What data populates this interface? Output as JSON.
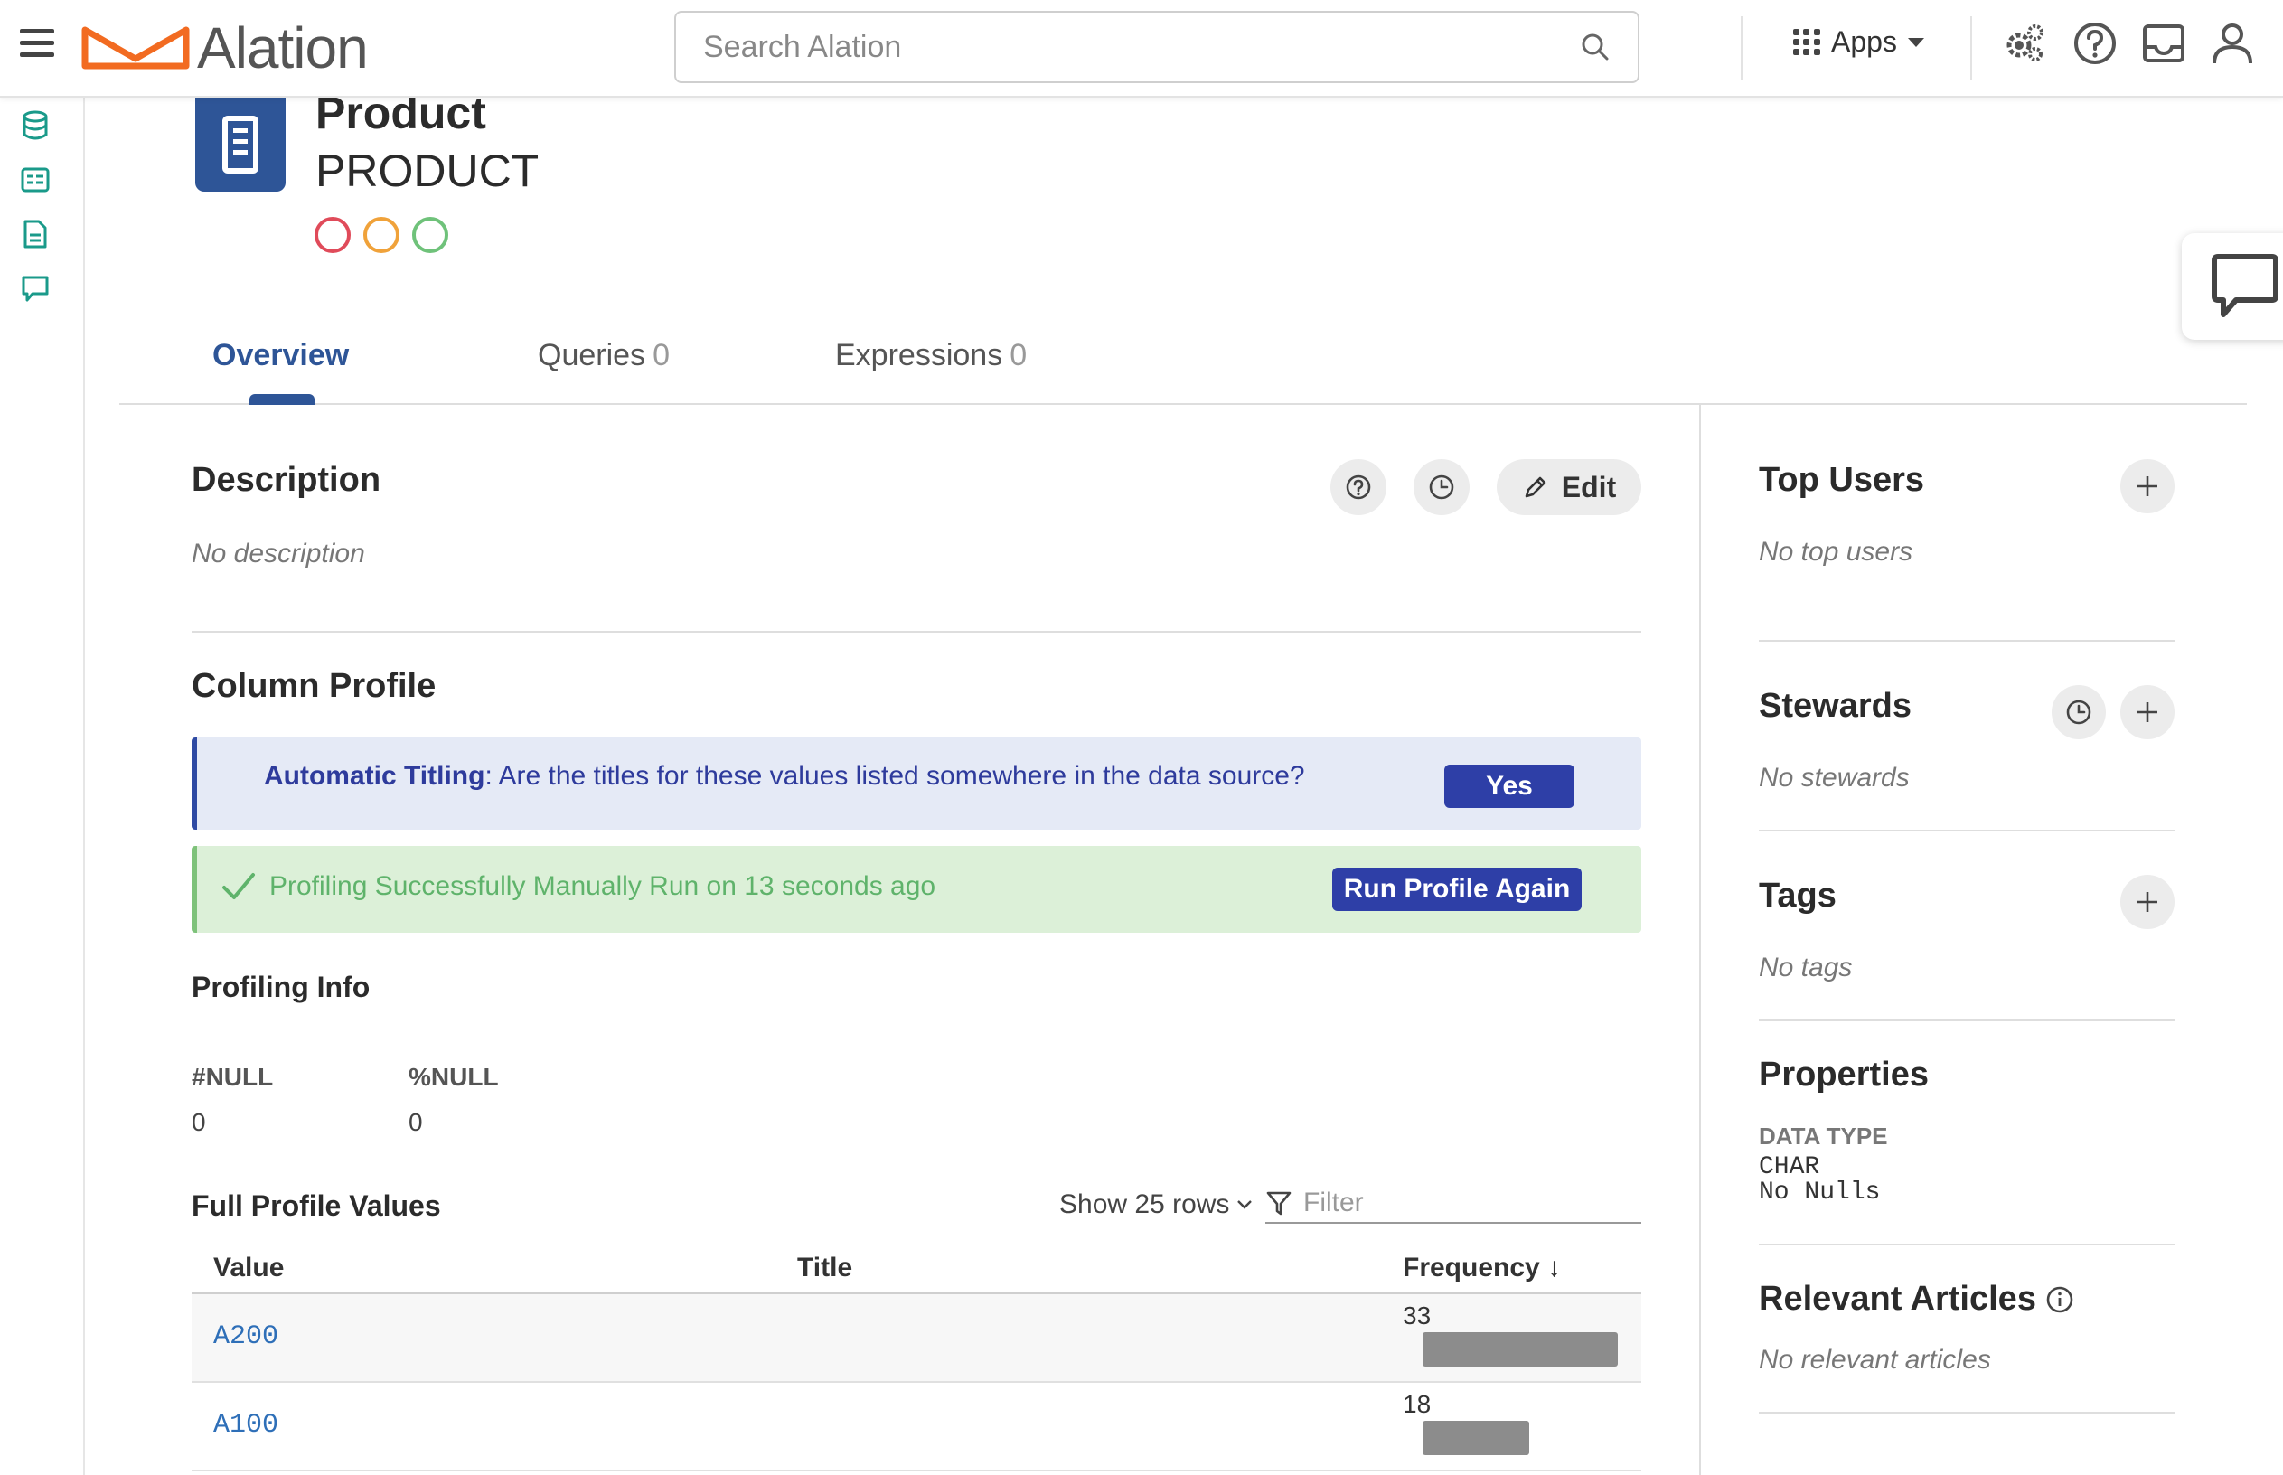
{
  "app": {
    "brand": "Alation",
    "search_placeholder": "Search Alation",
    "apps_label": "Apps"
  },
  "header": {
    "title": "Product",
    "subtitle": "PRODUCT"
  },
  "tabs": [
    {
      "label": "Overview",
      "count": ""
    },
    {
      "label": "Queries",
      "count": "0"
    },
    {
      "label": "Expressions",
      "count": "0"
    }
  ],
  "description": {
    "title": "Description",
    "empty": "No description",
    "edit_label": "Edit"
  },
  "column_profile": {
    "title": "Column Profile",
    "titling_bold": "Automatic Titling",
    "titling_text": ": Are the titles for these values listed somewhere in the data source?",
    "yes_label": "Yes",
    "success_text": "Profiling Successfully Manually Run on 13 seconds ago",
    "run_again_label": "Run Profile Again",
    "profiling_info_title": "Profiling Info",
    "stats": [
      {
        "label": "#NULL",
        "value": "0"
      },
      {
        "label": "%NULL",
        "value": "0"
      }
    ],
    "full_profile_title": "Full Profile Values",
    "show_rows": "Show 25 rows",
    "filter_placeholder": "Filter",
    "columns": [
      "Value",
      "Title",
      "Frequency ↓"
    ],
    "rows": [
      {
        "value": "A200",
        "title": "",
        "frequency": "33",
        "bar_fraction": 1.0
      },
      {
        "value": "A100",
        "title": "",
        "frequency": "18",
        "bar_fraction": 0.545
      }
    ]
  },
  "sidebar": {
    "top_users": {
      "title": "Top Users",
      "empty": "No top users"
    },
    "stewards": {
      "title": "Stewards",
      "empty": "No stewards"
    },
    "tags": {
      "title": "Tags",
      "empty": "No tags"
    },
    "properties": {
      "title": "Properties",
      "data_type_label": "DATA TYPE",
      "data_type": "CHAR",
      "nulls": "No Nulls"
    },
    "relevant_articles": {
      "title": "Relevant Articles",
      "empty": "No relevant articles"
    }
  },
  "colors": {
    "accent": "#2e5597",
    "primary_button": "#2e3fa7",
    "info_banner": "#e5eaf6",
    "success_banner": "#dcf0d8",
    "success_text": "#5fb36b",
    "logo_orange": "#f26b21",
    "rail_teal": "#1a9a8a",
    "trust_red": "#e04b5a",
    "trust_orange": "#f0a23a",
    "trust_green": "#6fc27a"
  },
  "icons": [
    "hamburger-icon",
    "search-icon",
    "apps-grid-icon",
    "settings-icon",
    "help-icon",
    "inbox-icon",
    "user-icon",
    "database-icon",
    "catalog-icon",
    "document-icon",
    "conversation-icon",
    "chat-icon",
    "help-circle-icon",
    "history-icon",
    "pencil-icon",
    "plus-icon",
    "check-icon",
    "filter-icon",
    "info-icon"
  ]
}
